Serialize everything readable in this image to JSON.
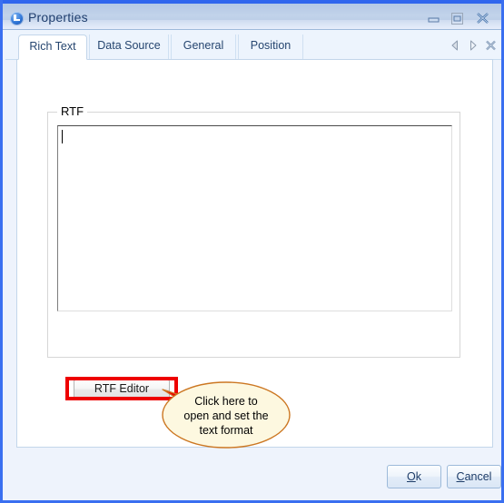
{
  "window": {
    "title": "Properties",
    "icon": "app-logo-icon",
    "controls": [
      {
        "name": "minimize",
        "glyph": "minimize-icon"
      },
      {
        "name": "maximize",
        "glyph": "restore-icon"
      },
      {
        "name": "close",
        "glyph": "close-icon"
      }
    ]
  },
  "tabs": {
    "items": [
      {
        "label": "Rich Text",
        "active": true
      },
      {
        "label": "Data Source",
        "active": false
      },
      {
        "label": "General",
        "active": false
      },
      {
        "label": "Position",
        "active": false
      }
    ],
    "nav": [
      {
        "name": "scroll-tabs-left-icon",
        "glyph": "triangle-left"
      },
      {
        "name": "scroll-tabs-right-icon",
        "glyph": "triangle-right"
      },
      {
        "name": "close-tab-icon",
        "glyph": "close-cross"
      }
    ]
  },
  "rich_text_page": {
    "group_label": "RTF",
    "textarea_value": "",
    "textarea_placeholder": "",
    "editor_button_label": "RTF Editor"
  },
  "annotation": {
    "callout_text": "Click here to\nopen and set the\ntext format",
    "highlight_color": "#ee0000",
    "callout_fill": "#fdf8e0",
    "callout_border": "#cc7722"
  },
  "footer": {
    "ok_label": "Ok",
    "ok_accel": "O",
    "ok_rest": "k",
    "cancel_label": "Cancel",
    "cancel_accel": "C",
    "cancel_rest": "ancel"
  },
  "colors": {
    "window_border": "#3a6ff0",
    "titlebar_top": "#2f66ee",
    "tabstrip_bg": "#edf4fd",
    "page_bg": "#ffffff",
    "footer_bg": "#eef3fc"
  }
}
